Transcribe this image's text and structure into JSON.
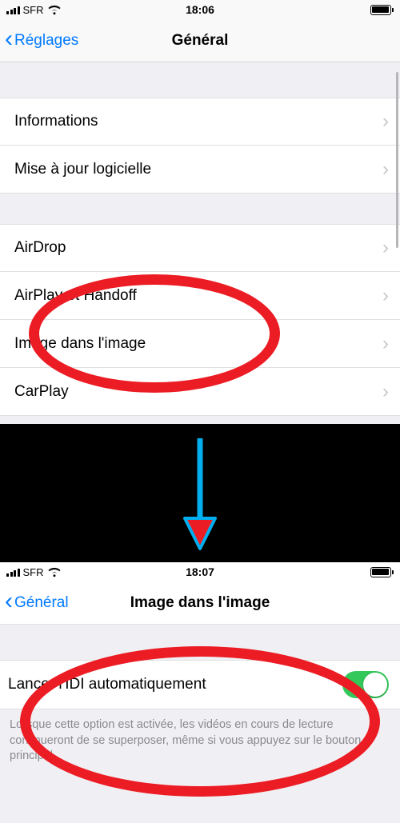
{
  "screen1": {
    "status": {
      "carrier": "SFR",
      "time": "18:06"
    },
    "nav": {
      "back": "Réglages",
      "title": "Général"
    },
    "group1": [
      {
        "label": "Informations"
      },
      {
        "label": "Mise à jour logicielle"
      }
    ],
    "group2": [
      {
        "label": "AirDrop"
      },
      {
        "label": "AirPlay et Handoff"
      },
      {
        "label": "Image dans l'image"
      },
      {
        "label": "CarPlay"
      }
    ]
  },
  "screen2": {
    "status": {
      "carrier": "SFR",
      "time": "18:07"
    },
    "nav": {
      "back": "Général",
      "title": "Image dans l'image"
    },
    "toggle": {
      "label": "Lancer l'IDI automatiquement",
      "on": true
    },
    "footer": "Lorsque cette option est activée, les vidéos en cours de lecture continueront de se superposer, même si vous appuyez sur le bouton principal."
  },
  "colors": {
    "accent": "#007aff",
    "switch_on": "#34c759",
    "highlight": "#ec1c24"
  }
}
